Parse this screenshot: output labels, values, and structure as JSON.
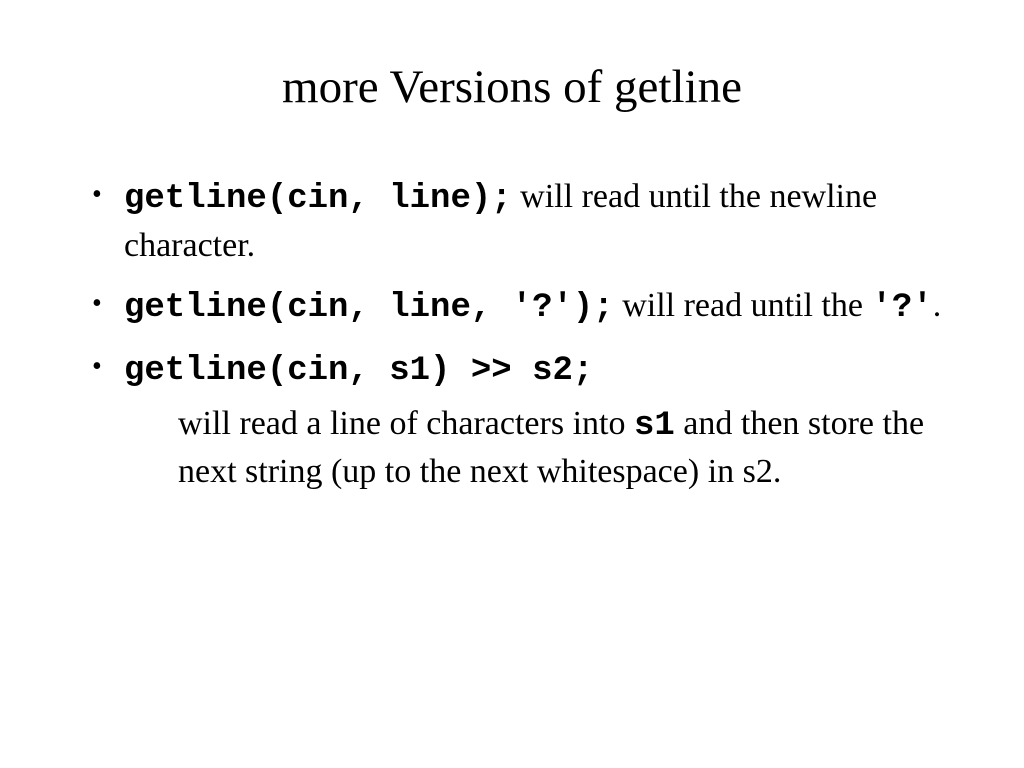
{
  "title": "more Versions of getline",
  "items": [
    {
      "code": "getline(cin, line);",
      "text_a": "  will read until the newline character."
    },
    {
      "code": "getline(cin, line, '?');",
      "text_a": "  will read until the ",
      "code_b": "'?'",
      "text_c": "."
    },
    {
      "code": "getline(cin, s1) >> s2;",
      "sub_a": "will read a line of characters into ",
      "sub_code": "s1",
      "sub_b": " and then store the next string (up to the next whitespace) in s2."
    }
  ]
}
